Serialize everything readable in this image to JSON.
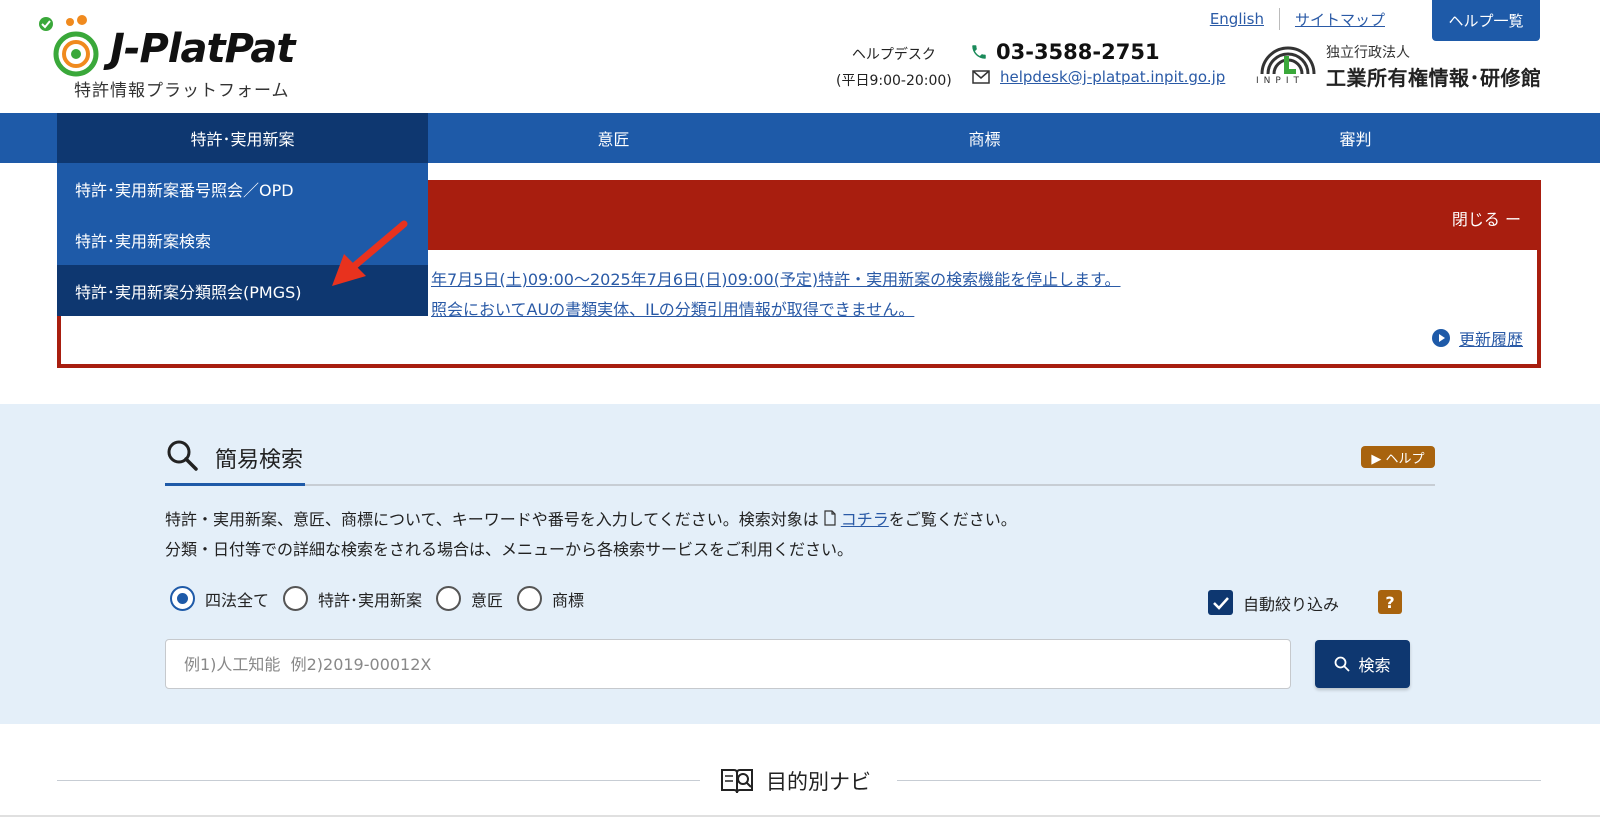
{
  "header": {
    "logo_text": "J-PlatPat",
    "logo_sub": "特許情報プラットフォーム",
    "links": [
      "English",
      "サイトマップ"
    ],
    "help_list_label": "ヘルプ一覧",
    "helpdesk_label": "ヘルプデスク",
    "helpdesk_hours": "(平日9:00-20:00)",
    "phone": "03-3588-2751",
    "email": "helpdesk@j-platpat.inpit.go.jp",
    "org_line1": "独立行政法人",
    "org_line2": "工業所有権情報･研修館",
    "org_word": "INPIT"
  },
  "nav": {
    "items": [
      "特許･実用新案",
      "意匠",
      "商標",
      "審判"
    ],
    "active_index": 0
  },
  "dropdown": {
    "items": [
      "特許･実用新案番号照会／OPD",
      "特許･実用新案検索",
      "特許･実用新案分類照会(PMGS)"
    ],
    "hover_index": 2
  },
  "notice": {
    "close_label": "閉じる ー",
    "lines": [
      "年7月5日(土)09:00〜2025年7月6日(日)09:00(予定)特許・実用新案の検索機能を停止します。",
      "照会においてAUの書類実体、ILの分類引用情報が取得できません。"
    ],
    "history_label": "更新履歴",
    "border_color": "#a81e0f"
  },
  "search": {
    "title": "簡易検索",
    "help_label": "▶ ヘルプ",
    "desc_line1_pre": "特許・実用新案、意匠、商標について、キーワードや番号を入力してください。検索対象は",
    "desc_line1_link": "コチラ",
    "desc_line1_post": "をご覧ください。",
    "desc_line2": "分類・日付等での詳細な検索をされる場合は、メニューから各検索サービスをご利用ください。",
    "radio_options": [
      "四法全て",
      "特許･実用新案",
      "意匠",
      "商標"
    ],
    "selected_radio": 0,
    "auto_filter_label": "自動絞り込み",
    "auto_filter_checked": true,
    "question_label": "?",
    "input_placeholder": "例1)人工知能  例2)2019-00012X",
    "input_value": "",
    "search_button_label": "検索"
  },
  "purpose_nav": {
    "title": "目的別ナビ"
  },
  "colors": {
    "nav_blue": "#1e5aa8",
    "nav_dark": "#0e3770",
    "notice_red": "#a81e0f",
    "section_bg": "#e4eff9",
    "help_brown": "#a8630e",
    "arrow_red": "#e8321e"
  }
}
